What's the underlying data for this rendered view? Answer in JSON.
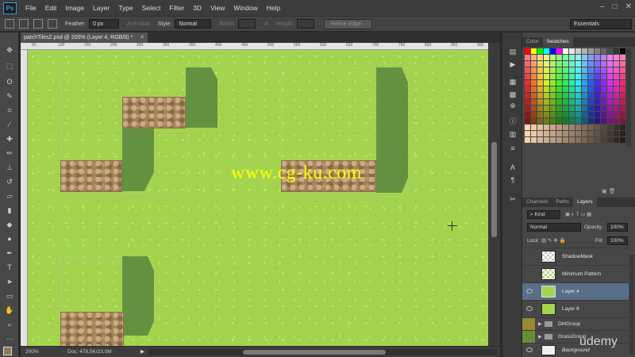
{
  "app": {
    "logo": "Ps",
    "menu": [
      "File",
      "Edit",
      "Image",
      "Layer",
      "Type",
      "Select",
      "Filter",
      "3D",
      "View",
      "Window",
      "Help"
    ]
  },
  "options_bar": {
    "feather_label": "Feather:",
    "feather_value": "0 px",
    "antialias_label": "Anti-alias",
    "style_label": "Style:",
    "style_value": "Normal",
    "width_label": "Width:",
    "height_label": "Height:",
    "refine_edge": "Refine Edge...",
    "workspace": "Essentials"
  },
  "document": {
    "tab_title": "patchTiles2.psd @ 200% (Layer 4, RGB/8) *",
    "ruler_ticks": [
      "50",
      "100",
      "150",
      "200",
      "250",
      "300",
      "350",
      "400",
      "450",
      "500",
      "550",
      "600",
      "650",
      "700",
      "750",
      "800",
      "850",
      "900"
    ],
    "watermark": "www.cg-ku.com"
  },
  "status": {
    "zoom": "200%",
    "doc_info": "Doc: 478,5K/23,0M"
  },
  "swatch_panel": {
    "tabs": [
      "Color",
      "Swatches"
    ],
    "active_tab": "Swatches"
  },
  "layers_panel": {
    "tabs": [
      "Channels",
      "Paths",
      "Layers"
    ],
    "active_tab": "Layers",
    "kind_filter": "Kind",
    "blend_mode": "Normal",
    "opacity_label": "Opacity:",
    "opacity_value": "100%",
    "lock_label": "Lock:",
    "fill_label": "Fill:",
    "fill_value": "100%",
    "layers": [
      {
        "name": "ShadowMask",
        "visible": false,
        "type": "layer"
      },
      {
        "name": "Minimum Pattern",
        "visible": false,
        "type": "layer"
      },
      {
        "name": "Layer 4",
        "visible": true,
        "type": "layer",
        "selected": true
      },
      {
        "name": "Layer 6",
        "visible": true,
        "type": "layer"
      },
      {
        "name": "DirtGroup",
        "visible": true,
        "type": "group"
      },
      {
        "name": "GrassGroup",
        "visible": true,
        "type": "group"
      },
      {
        "name": "Background",
        "visible": true,
        "type": "layer"
      }
    ]
  },
  "overlay": {
    "brand": "udemy"
  },
  "colors": {
    "grass": "#a4d44f",
    "dirt": "#a5825a",
    "shadow": "#5e8b3f",
    "watermark": "#ffff00",
    "selected_layer": "#5a6e8a"
  }
}
